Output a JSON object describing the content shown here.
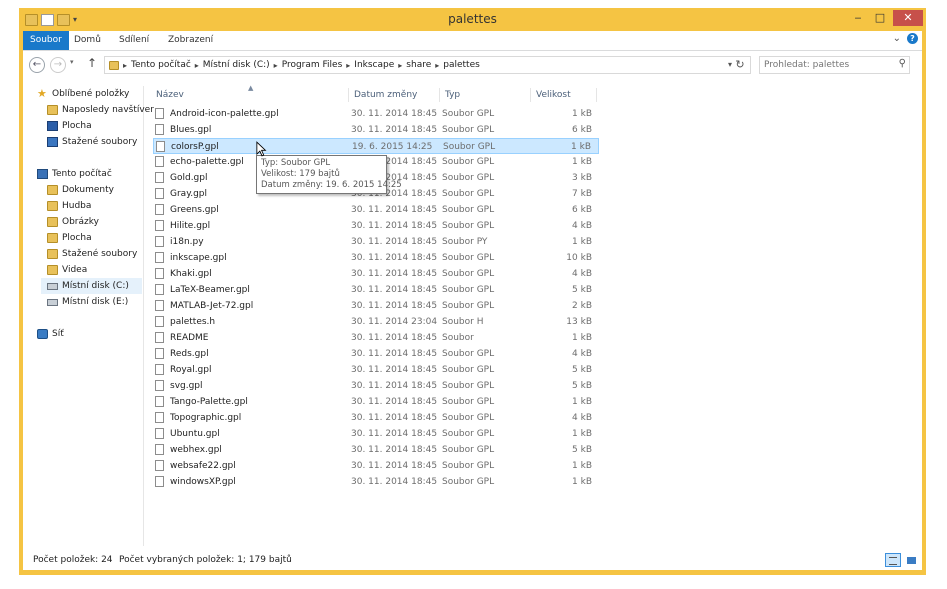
{
  "window": {
    "title": "palettes",
    "controls": {
      "minimize": "‒",
      "maximize": "□",
      "close": "✕"
    }
  },
  "ribbon": {
    "tabs": [
      "Soubor",
      "Domů",
      "Sdílení",
      "Zobrazení"
    ],
    "expand_glyph": "⌄",
    "help_glyph": "?"
  },
  "navigation": {
    "back_glyph": "←",
    "forward_glyph": "→",
    "up_glyph": "↑",
    "breadcrumbs": [
      "Tento počítač",
      "Místní disk (C:)",
      "Program Files",
      "Inkscape",
      "share",
      "palettes"
    ],
    "search_placeholder": "Prohledat: palettes"
  },
  "sidebar": {
    "favorites_title": "Oblíbené položky",
    "favorites": [
      "Naposledy navštíver",
      "Plocha",
      "Stažené soubory"
    ],
    "computer_title": "Tento počítač",
    "computer_items": [
      "Dokumenty",
      "Hudba",
      "Obrázky",
      "Plocha",
      "Stažené soubory",
      "Videa",
      "Místní disk (C:)",
      "Místní disk (E:)"
    ],
    "network_title": "Síť",
    "selected": "Místní disk (C:)"
  },
  "columns": {
    "name": "Název",
    "date": "Datum změny",
    "type": "Typ",
    "size": "Velikost"
  },
  "files": [
    {
      "name": "Android-icon-palette.gpl",
      "date": "30. 11. 2014 18:45",
      "type": "Soubor GPL",
      "size": "1 kB"
    },
    {
      "name": "Blues.gpl",
      "date": "30. 11. 2014 18:45",
      "type": "Soubor GPL",
      "size": "6 kB"
    },
    {
      "name": "colorsP.gpl",
      "date": "19. 6. 2015 14:25",
      "type": "Soubor GPL",
      "size": "1 kB"
    },
    {
      "name": "echo-palette.gpl",
      "date": "30. 11. 2014 18:45",
      "type": "Soubor GPL",
      "size": "1 kB"
    },
    {
      "name": "Gold.gpl",
      "date": "30. 11. 2014 18:45",
      "type": "Soubor GPL",
      "size": "3 kB"
    },
    {
      "name": "Gray.gpl",
      "date": "30. 11. 2014 18:45",
      "type": "Soubor GPL",
      "size": "7 kB"
    },
    {
      "name": "Greens.gpl",
      "date": "30. 11. 2014 18:45",
      "type": "Soubor GPL",
      "size": "6 kB"
    },
    {
      "name": "Hilite.gpl",
      "date": "30. 11. 2014 18:45",
      "type": "Soubor GPL",
      "size": "4 kB"
    },
    {
      "name": "i18n.py",
      "date": "30. 11. 2014 18:45",
      "type": "Soubor PY",
      "size": "1 kB"
    },
    {
      "name": "inkscape.gpl",
      "date": "30. 11. 2014 18:45",
      "type": "Soubor GPL",
      "size": "10 kB"
    },
    {
      "name": "Khaki.gpl",
      "date": "30. 11. 2014 18:45",
      "type": "Soubor GPL",
      "size": "4 kB"
    },
    {
      "name": "LaTeX-Beamer.gpl",
      "date": "30. 11. 2014 18:45",
      "type": "Soubor GPL",
      "size": "5 kB"
    },
    {
      "name": "MATLAB-Jet-72.gpl",
      "date": "30. 11. 2014 18:45",
      "type": "Soubor GPL",
      "size": "2 kB"
    },
    {
      "name": "palettes.h",
      "date": "30. 11. 2014 23:04",
      "type": "Soubor H",
      "size": "13 kB"
    },
    {
      "name": "README",
      "date": "30. 11. 2014 18:45",
      "type": "Soubor",
      "size": "1 kB"
    },
    {
      "name": "Reds.gpl",
      "date": "30. 11. 2014 18:45",
      "type": "Soubor GPL",
      "size": "4 kB"
    },
    {
      "name": "Royal.gpl",
      "date": "30. 11. 2014 18:45",
      "type": "Soubor GPL",
      "size": "5 kB"
    },
    {
      "name": "svg.gpl",
      "date": "30. 11. 2014 18:45",
      "type": "Soubor GPL",
      "size": "5 kB"
    },
    {
      "name": "Tango-Palette.gpl",
      "date": "30. 11. 2014 18:45",
      "type": "Soubor GPL",
      "size": "1 kB"
    },
    {
      "name": "Topographic.gpl",
      "date": "30. 11. 2014 18:45",
      "type": "Soubor GPL",
      "size": "4 kB"
    },
    {
      "name": "Ubuntu.gpl",
      "date": "30. 11. 2014 18:45",
      "type": "Soubor GPL",
      "size": "1 kB"
    },
    {
      "name": "webhex.gpl",
      "date": "30. 11. 2014 18:45",
      "type": "Soubor GPL",
      "size": "5 kB"
    },
    {
      "name": "websafe22.gpl",
      "date": "30. 11. 2014 18:45",
      "type": "Soubor GPL",
      "size": "1 kB"
    },
    {
      "name": "windowsXP.gpl",
      "date": "30. 11. 2014 18:45",
      "type": "Soubor GPL",
      "size": "1 kB"
    }
  ],
  "selected_file": "colorsP.gpl",
  "tooltip": {
    "type": "Typ: Soubor GPL",
    "size": "Velikost: 179 bajtů",
    "date": "Datum změny: 19. 6. 2015 14:25"
  },
  "status": {
    "count": "Počet položek: 24",
    "selected": "Počet vybraných položek: 1; 179 bajtů"
  },
  "colors": {
    "frame": "#f5c443",
    "accent": "#1979ca",
    "selection": "#cce8ff"
  }
}
